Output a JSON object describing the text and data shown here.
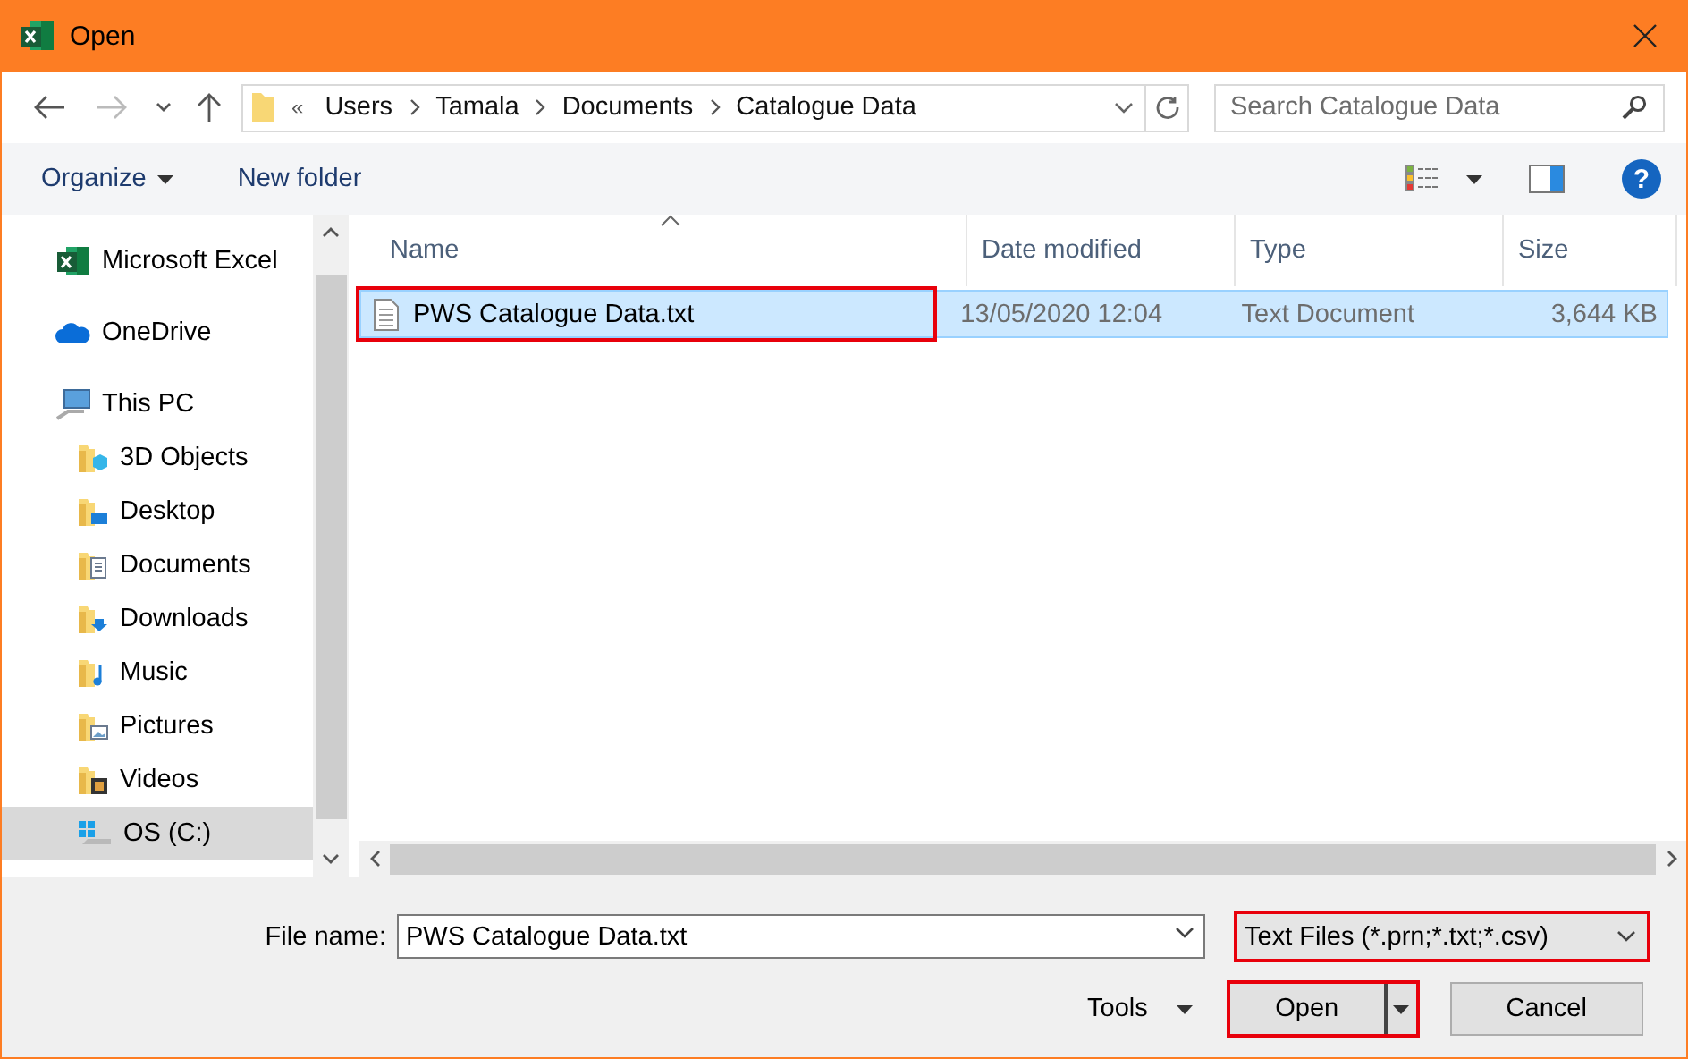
{
  "window": {
    "title": "Open"
  },
  "address": {
    "overflow": "«",
    "crumbs": [
      "Users",
      "Tamala",
      "Documents",
      "Catalogue Data"
    ]
  },
  "search": {
    "placeholder": "Search Catalogue Data"
  },
  "toolbar": {
    "organize": "Organize",
    "new_folder": "New folder",
    "help": "?"
  },
  "sidebar": {
    "items": [
      {
        "label": "Microsoft Excel",
        "selected": false
      },
      {
        "label": "OneDrive",
        "selected": false
      },
      {
        "label": "This PC",
        "selected": false,
        "children": [
          {
            "label": "3D Objects",
            "selected": false
          },
          {
            "label": "Desktop",
            "selected": false
          },
          {
            "label": "Documents",
            "selected": false
          },
          {
            "label": "Downloads",
            "selected": false
          },
          {
            "label": "Music",
            "selected": false
          },
          {
            "label": "Pictures",
            "selected": false
          },
          {
            "label": "Videos",
            "selected": false
          },
          {
            "label": "OS (C:)",
            "selected": true
          }
        ]
      }
    ]
  },
  "table": {
    "columns": [
      "Name",
      "Date modified",
      "Type",
      "Size"
    ],
    "rows": [
      {
        "cells": [
          "PWS Catalogue Data.txt",
          "13/05/2020 12:04",
          "Text Document",
          "3,644 KB"
        ],
        "selected": true,
        "highlighted": true
      }
    ]
  },
  "footer": {
    "file_name_label": "File name:",
    "file_name": "PWS Catalogue Data.txt",
    "file_type": "Text Files (*.prn;*.txt;*.csv)",
    "file_type_highlighted": true,
    "tools": "Tools",
    "open": "Open",
    "open_highlighted": true,
    "cancel": "Cancel"
  }
}
